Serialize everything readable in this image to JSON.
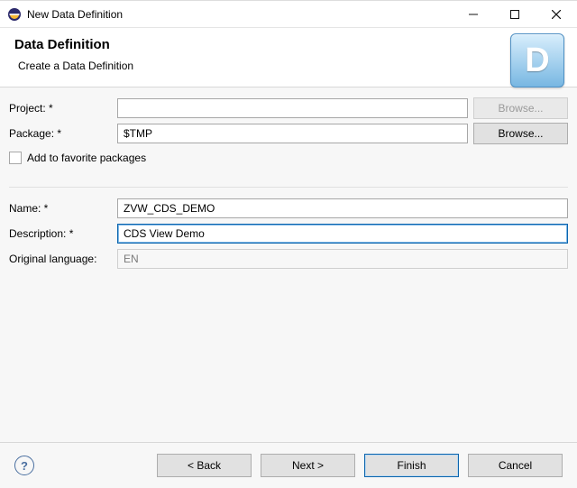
{
  "window": {
    "title": "New Data Definition"
  },
  "header": {
    "title": "Data Definition",
    "subtitle": "Create a Data Definition",
    "icon_letter": "D"
  },
  "form": {
    "project": {
      "label": "Project: *",
      "value": "",
      "browse": "Browse...",
      "browse_enabled": false
    },
    "package": {
      "label": "Package: *",
      "value": "$TMP",
      "browse": "Browse...",
      "browse_enabled": true
    },
    "favorite_label": "Add to favorite packages",
    "favorite_checked": false,
    "name": {
      "label": "Name: *",
      "value": "ZVW_CDS_DEMO"
    },
    "description": {
      "label": "Description: *",
      "value": "CDS View Demo"
    },
    "original_language": {
      "label": "Original language:",
      "value": "EN"
    }
  },
  "footer": {
    "back": "< Back",
    "next": "Next >",
    "finish": "Finish",
    "cancel": "Cancel"
  }
}
